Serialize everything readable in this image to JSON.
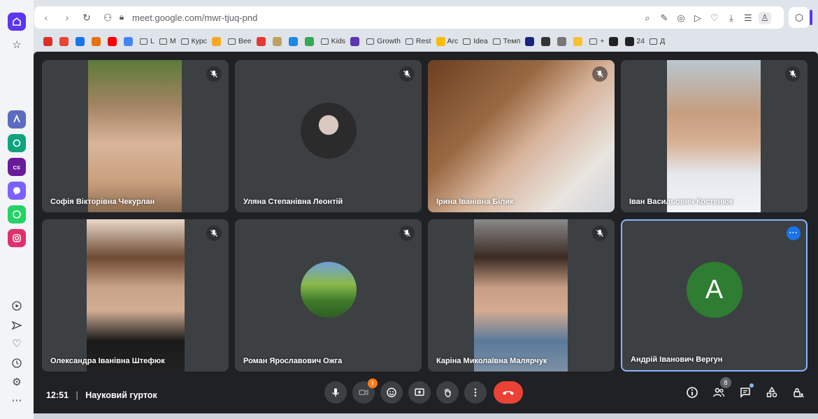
{
  "browser": {
    "url": "meet.google.com/mwr-tjuq-pnd"
  },
  "bookmarks": [
    {
      "label": "",
      "kind": "icon",
      "color": "#d93025"
    },
    {
      "label": "",
      "kind": "icon",
      "color": "#ea4335"
    },
    {
      "label": "",
      "kind": "icon",
      "color": "#1a73e8"
    },
    {
      "label": "",
      "kind": "icon",
      "color": "#e8710a"
    },
    {
      "label": "",
      "kind": "icon",
      "color": "#ff0000"
    },
    {
      "label": "",
      "kind": "icon",
      "color": "#4285f4"
    },
    {
      "label": "L",
      "kind": "folder"
    },
    {
      "label": "M",
      "kind": "folder"
    },
    {
      "label": "Курс",
      "kind": "folder"
    },
    {
      "label": "",
      "kind": "icon",
      "color": "#f9a825"
    },
    {
      "label": "Bee",
      "kind": "folder"
    },
    {
      "label": "",
      "kind": "icon",
      "color": "#e53935"
    },
    {
      "label": "",
      "kind": "icon",
      "color": "#c0a060"
    },
    {
      "label": "",
      "kind": "icon",
      "color": "#1e88e5"
    },
    {
      "label": "",
      "kind": "icon",
      "color": "#34a853"
    },
    {
      "label": "Kids",
      "kind": "folder"
    },
    {
      "label": "",
      "kind": "icon",
      "color": "#5e35b1"
    },
    {
      "label": "Growth",
      "kind": "folder"
    },
    {
      "label": "Rest",
      "kind": "folder"
    },
    {
      "label": "Arc",
      "kind": "icon",
      "color": "#fbbc04"
    },
    {
      "label": "Idea",
      "kind": "folder"
    },
    {
      "label": "Темп",
      "kind": "folder"
    },
    {
      "label": "",
      "kind": "icon",
      "color": "#1a237e"
    },
    {
      "label": "",
      "kind": "icon",
      "color": "#333333"
    },
    {
      "label": "",
      "kind": "icon",
      "color": "#777777"
    },
    {
      "label": "",
      "kind": "icon",
      "color": "#fbc02d"
    },
    {
      "label": "+",
      "kind": "folder"
    },
    {
      "label": "",
      "kind": "icon",
      "color": "#222222"
    },
    {
      "label": "24",
      "kind": "icon",
      "color": "#222222"
    },
    {
      "label": "Д",
      "kind": "folder"
    }
  ],
  "participants": [
    {
      "name": "Софія Вікторівна Чекурлан",
      "muted": true
    },
    {
      "name": "Уляна Степанівна Леонтій",
      "muted": true
    },
    {
      "name": "Ірина Іванівна Білик",
      "muted": true
    },
    {
      "name": "Іван Васильович Костенюк",
      "muted": true
    },
    {
      "name": "Олександра Іванівна Штефюк",
      "muted": true
    },
    {
      "name": "Роман Ярославович Ожга",
      "muted": true
    },
    {
      "name": "Каріна Миколаївна Малярчук",
      "muted": true
    },
    {
      "name": "Андрій Іванович Вергун",
      "muted": false,
      "avatar_letter": "A"
    }
  ],
  "meeting": {
    "time": "12:51",
    "separator": "|",
    "title": "Науковий гурток",
    "people_count": "8",
    "warning_badge": "!",
    "more_dots": "···"
  },
  "colors": {
    "accent": "#1a73e8",
    "end_call": "#ea4335",
    "avatar_bg": "#2e7d32"
  }
}
